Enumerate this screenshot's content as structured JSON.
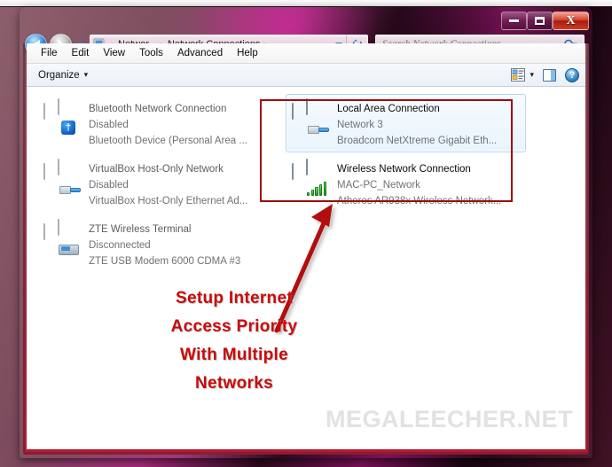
{
  "window": {
    "buttons": {
      "minimize": "–",
      "maximize": "□",
      "close": "X"
    }
  },
  "nav": {
    "back_icon": "back-arrow-icon",
    "forward_icon": "forward-arrow-icon",
    "recent_icon": "chevron-down-icon",
    "address": {
      "icon": "network-folder-icon",
      "crumb_overflow": "«",
      "crumb1": "Networ...",
      "crumb2": "Network Connections",
      "sep": "▸",
      "dropdown_icon": "chevron-down-icon",
      "refresh_icon": "↻"
    },
    "search": {
      "placeholder": "Search Network Connections",
      "icon": "search-icon"
    }
  },
  "menubar": {
    "items": [
      "File",
      "Edit",
      "View",
      "Tools",
      "Advanced",
      "Help"
    ]
  },
  "toolbar": {
    "organize_label": "Organize",
    "organize_caret": "▾",
    "views_icon": "change-view-icon",
    "views_caret": "▾",
    "preview_icon": "preview-pane-icon",
    "help_icon": "?"
  },
  "connections": {
    "left_column": [
      {
        "name": "Bluetooth Network Connection",
        "status": "Disabled",
        "device": "Bluetooth Device (Personal Area ...",
        "icon": "network-adapter-gray-icon",
        "badge": "bluetooth-badge-icon",
        "selected": false,
        "enabled": false
      },
      {
        "name": "VirtualBox Host-Only Network",
        "status": "Disabled",
        "device": "VirtualBox Host-Only Ethernet Ad...",
        "icon": "network-adapter-gray-icon",
        "badge": "ethernet-plug-badge-icon",
        "selected": false,
        "enabled": false
      },
      {
        "name": "ZTE Wireless Terminal",
        "status": "Disconnected",
        "device": "ZTE USB Modem 6000 CDMA #3",
        "icon": "network-adapter-gray-icon",
        "badge": "modem-badge-icon",
        "selected": false,
        "enabled": false
      }
    ],
    "right_column": [
      {
        "name": "Local Area Connection",
        "status": "Network  3",
        "device": "Broadcom NetXtreme Gigabit Eth...",
        "icon": "network-adapter-blue-icon",
        "badge": "ethernet-plug-badge-icon",
        "selected": true,
        "enabled": true
      },
      {
        "name": "Wireless Network Connection",
        "status": "MAC-PC_Network",
        "device": "Atheros AR938x Wireless Network...",
        "icon": "network-adapter-blue-icon",
        "badge": "wifi-signal-badge-icon",
        "selected": false,
        "enabled": true
      }
    ]
  },
  "annotation": {
    "lines": [
      "Setup Internet",
      "Access Priority",
      "With Multiple",
      "Networks"
    ],
    "color": "#c90a0a",
    "highlight_box_color": "#9e0b0b",
    "arrow_icon": "pointer-arrow-icon"
  },
  "watermark": {
    "text": "MEGALEECHER.NET",
    "color": "#e2e2e2"
  }
}
